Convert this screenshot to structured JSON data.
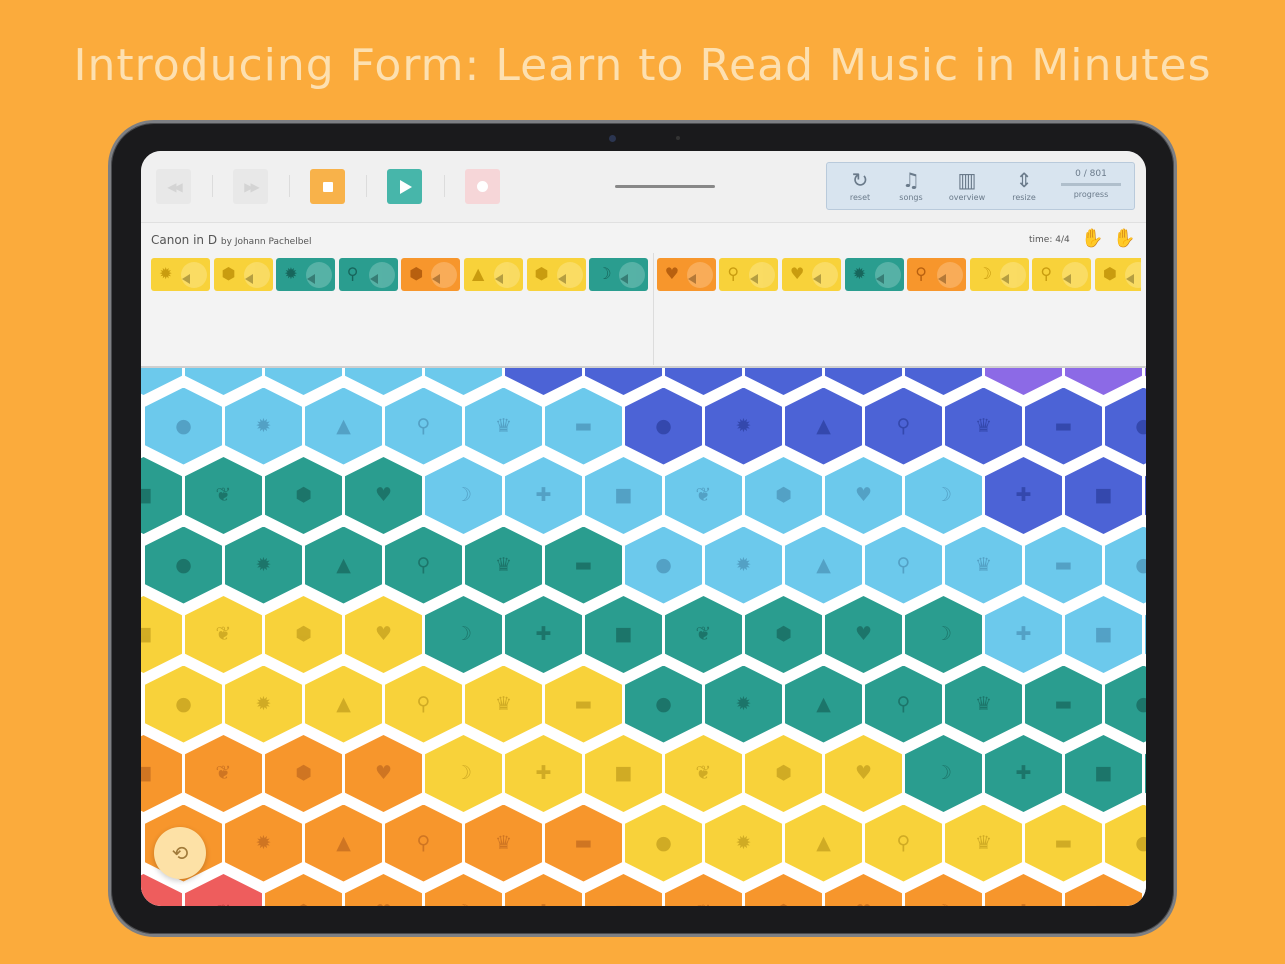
{
  "headline": "Introducing Form: Learn to Read Music in Minutes",
  "toolbar": {
    "rewind_icon": "rewind-icon",
    "fast_forward_icon": "fast-forward-icon",
    "stop_color": "#f8b24a",
    "play_color": "#47b6aa",
    "record_color": "#f6d6d8"
  },
  "panel": {
    "reset": "reset",
    "songs": "songs",
    "overview": "overview",
    "resize": "resize",
    "progress_count": "0 / 801",
    "progress_label": "progress"
  },
  "song": {
    "title": "Canon in D",
    "by": "by Johann Pachelbel",
    "time": "time: 4/4"
  },
  "colors": {
    "yellow": "#f8d23a",
    "green": "#2a9d8f",
    "orange": "#f7962c",
    "blue": "#6cc9ec",
    "indigo": "#4c63d6",
    "violet": "#8c6ae6",
    "red": "#ee5d5d",
    "background": "#fbab3c"
  },
  "notes": [
    {
      "shape": "✹",
      "color": "yellow"
    },
    {
      "shape": "⬢",
      "color": "yellow"
    },
    {
      "shape": "✹",
      "color": "green"
    },
    {
      "shape": "⚲",
      "color": "green"
    },
    {
      "shape": "⬢",
      "color": "orange"
    },
    {
      "shape": "▲",
      "color": "yellow"
    },
    {
      "shape": "⬢",
      "color": "yellow"
    },
    {
      "shape": "☽",
      "color": "green"
    },
    {
      "shape": "♥",
      "color": "orange"
    },
    {
      "shape": "⚲",
      "color": "yellow"
    },
    {
      "shape": "♥",
      "color": "yellow"
    },
    {
      "shape": "✹",
      "color": "green"
    },
    {
      "shape": "⚲",
      "color": "orange"
    },
    {
      "shape": "☽",
      "color": "yellow"
    },
    {
      "shape": "⚲",
      "color": "yellow"
    },
    {
      "shape": "⬢",
      "color": "yellow"
    }
  ],
  "grid_symbols": {
    "odd_row": [
      "●",
      "✹",
      "▲",
      "⚲",
      "♛",
      "▬",
      "●",
      "✹",
      "▲",
      "⚲",
      "♛",
      "▬",
      "●"
    ],
    "even_row": [
      "■",
      "❦",
      "⬢",
      "♥",
      "☽",
      "✚",
      "■",
      "❦",
      "⬢",
      "♥",
      "☽",
      "✚",
      "■",
      "❦"
    ]
  },
  "fab_icon": "recenter-icon"
}
